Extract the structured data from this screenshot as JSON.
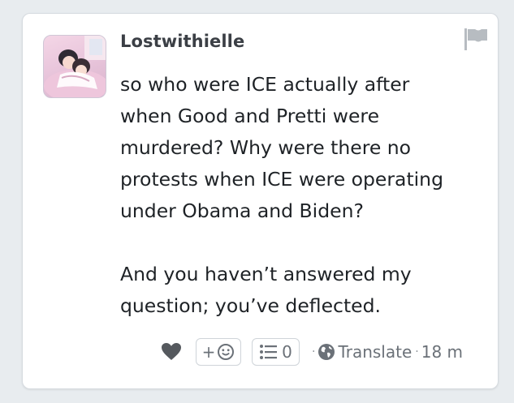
{
  "post": {
    "username": "Lostwithielle",
    "body_lines": [
      "so who were ICE actually after",
      "when Good and Pretti were",
      "murdered? Why were there no",
      "protests when ICE were operating",
      "under Obama and Biden?"
    ],
    "body_lines_2": [
      "And you haven’t answered my",
      "question; you’ve deflected."
    ]
  },
  "footer": {
    "react_label": "+",
    "comment_count": "0",
    "translate_label": "Translate",
    "separator": "·",
    "age": "18 m"
  },
  "colors": {
    "icon_gray": "#6b7178",
    "heart_gray": "#55595e",
    "text": "#1e2226"
  },
  "icons": [
    "flag-icon",
    "heart-icon",
    "smiley-icon",
    "list-icon",
    "globe-icon"
  ]
}
